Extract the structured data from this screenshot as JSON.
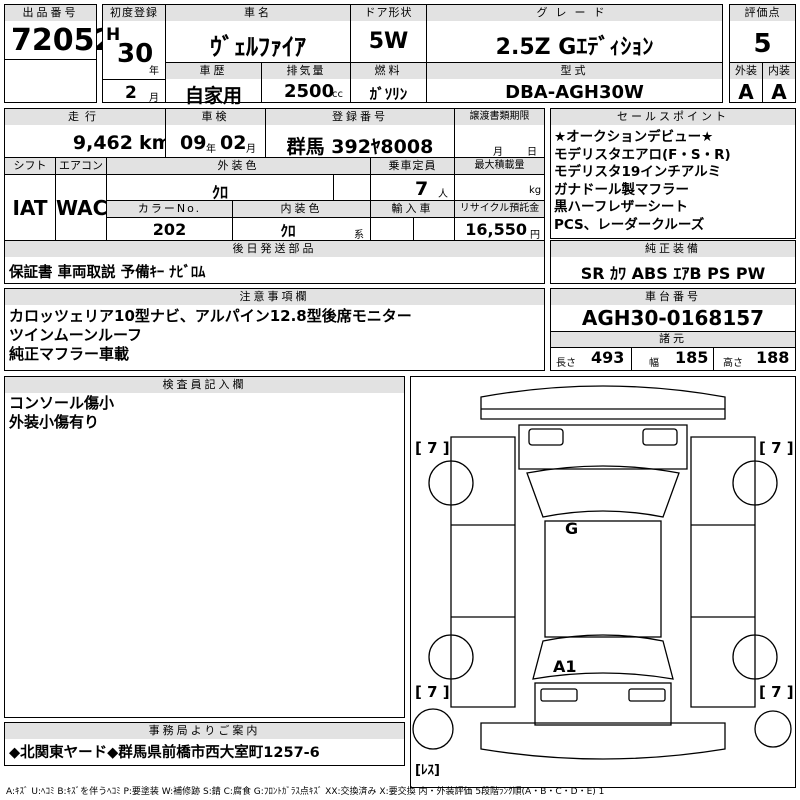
{
  "lot": {
    "label": "出品番号",
    "value": "72052"
  },
  "first_reg": {
    "label": "初度登録",
    "era": "H",
    "year": "30",
    "year_unit": "年",
    "month": "2",
    "month_unit": "月"
  },
  "car_name": {
    "label": "車名",
    "value": "ｳﾞｪﾙﾌｧｲｱ"
  },
  "door": {
    "label": "ドア形状",
    "value": "5W"
  },
  "grade": {
    "label": "グレード",
    "value": "2.5Z Gｴﾃﾞｨｼｮﾝ"
  },
  "score": {
    "label": "評価点",
    "value": "5"
  },
  "history": {
    "label": "車歴",
    "value": "自家用"
  },
  "displacement": {
    "label": "排気量",
    "value": "2500",
    "unit": "cc"
  },
  "fuel": {
    "label": "燃料",
    "value": "ｶﾞｿﾘﾝ"
  },
  "model": {
    "label": "型式",
    "value": "DBA-AGH30W"
  },
  "ext_grade": {
    "label": "外装",
    "value": "A"
  },
  "int_grade": {
    "label": "内装",
    "value": "A"
  },
  "mileage": {
    "label": "走行",
    "value": "9,462",
    "unit": "km"
  },
  "inspection": {
    "label": "車検",
    "year": "09",
    "year_unit": "年",
    "month": "02",
    "month_unit": "月"
  },
  "plate": {
    "label": "登録番号",
    "value": "群馬 392ﾔ8008"
  },
  "transfer": {
    "label": "譲渡書類期限",
    "month_unit": "月",
    "day_unit": "日"
  },
  "selling_points": {
    "label": "セールスポイント",
    "lines": [
      "★オークションデビュー★",
      "モデリスタエアロ(F・S・R)",
      "モデリスタ19インチアルミ",
      "ガナドール製マフラー",
      "黒ハーフレザーシート",
      "PCS、レーダークルーズ"
    ]
  },
  "shift": {
    "label": "シフト",
    "value": "IAT"
  },
  "aircon": {
    "label": "エアコン",
    "value": "WAC"
  },
  "ext_color": {
    "label": "外装色",
    "value": "ｸﾛ"
  },
  "capacity": {
    "label": "乗車定員",
    "value": "7",
    "unit": "人"
  },
  "max_load": {
    "label": "最大積載量",
    "unit": "kg"
  },
  "color_no": {
    "label": "カラーNo.",
    "value": "202"
  },
  "int_color": {
    "label": "内装色",
    "value": "ｸﾛ",
    "suffix": "系"
  },
  "import": {
    "label": "輸入車"
  },
  "recycle": {
    "label": "リサイクル預託金",
    "value": "16,550",
    "unit": "円"
  },
  "later_parts": {
    "label": "後日発送部品",
    "value": "保証書 車両取説 予備ｷｰ ﾅﾋﾞﾛﾑ"
  },
  "equipment": {
    "label": "純正装備",
    "value": "SR ｶﾜ ABS ｴｱB PS PW"
  },
  "notes": {
    "label": "注意事項欄",
    "lines": [
      "カロッツェリア10型ナビ、アルパイン12.8型後席モニター",
      "ツインムーンルーフ",
      "純正マフラー車載"
    ]
  },
  "chassis": {
    "label": "車台番号",
    "value": "AGH30-0168157"
  },
  "dims": {
    "label": "諸元",
    "length_label": "長さ",
    "length": "493",
    "width_label": "幅",
    "width": "185",
    "height_label": "高さ",
    "height": "188"
  },
  "inspector": {
    "label": "検査員記入欄",
    "lines": [
      "コンソール傷小",
      "外装小傷有り"
    ]
  },
  "diagram": {
    "tire_fl": "[ 7 ]",
    "tire_fr": "[ 7 ]",
    "tire_rl": "[ 7 ]",
    "tire_rr": "[ 7 ]",
    "mark_top": "G",
    "mark_bottom": "A1",
    "spare": "[ﾚｽ]"
  },
  "office": {
    "label": "事務局よりご案内",
    "value": "◆北関東ヤード◆群馬県前橋市西大室町1257-6"
  },
  "legend": "A:ｷｽﾞ U:ﾍｺﾐ B:ｷｽﾞを伴うﾍｺﾐ P:要塗装 W:補修跡 S:錆 C:腐食 G:ﾌﾛﾝﾄｶﾞﾗｽ点ｷｽﾞ XX:交換済み X:要交換 内・外装評価 5段階ﾗﾝｸ順(A・B・C・D・E) 1"
}
